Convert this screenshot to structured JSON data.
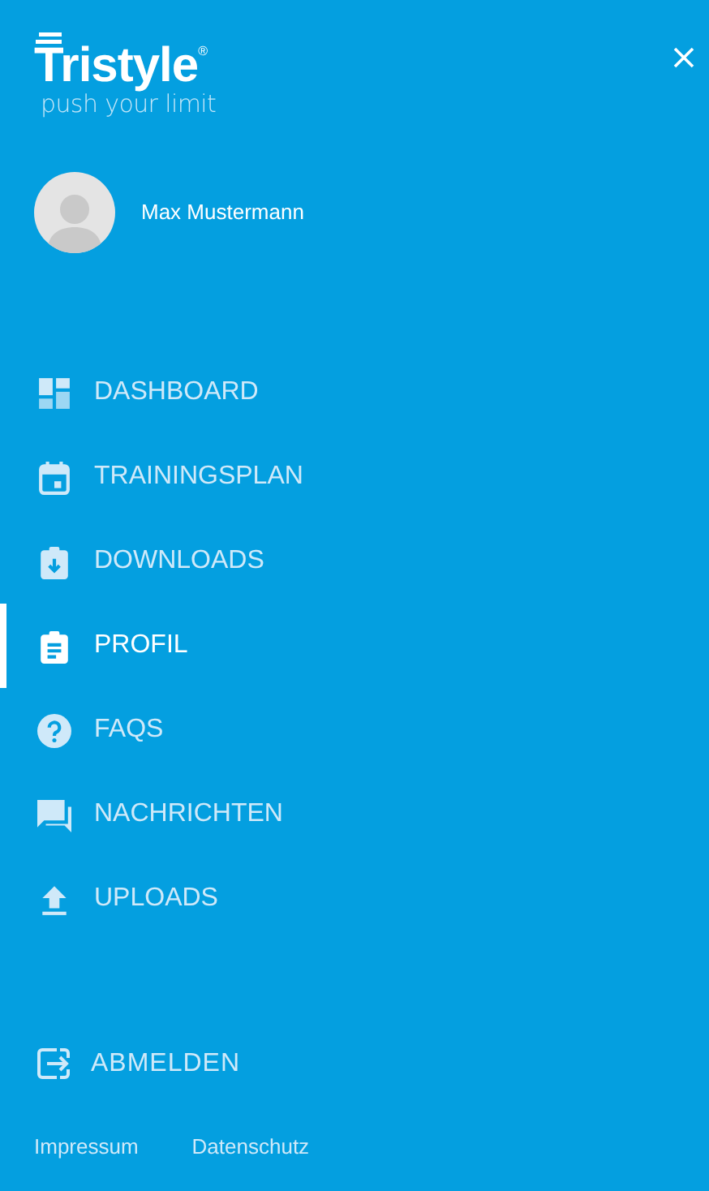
{
  "logo": {
    "name": "Tristyle",
    "mark": "®",
    "tagline": "push your limit"
  },
  "user": {
    "name": "Max Mustermann"
  },
  "nav": [
    {
      "label": "DASHBOARD",
      "selected": false
    },
    {
      "label": "TRAININGSPLAN",
      "selected": false
    },
    {
      "label": "DOWNLOADS",
      "selected": false
    },
    {
      "label": "PROFIL",
      "selected": true
    },
    {
      "label": "FAQS",
      "selected": false
    },
    {
      "label": "NACHRICHTEN",
      "selected": false
    },
    {
      "label": "UPLOADS",
      "selected": false
    }
  ],
  "logout": {
    "label": "ABMELDEN"
  },
  "footer_links": [
    "Impressum",
    "Datenschutz"
  ]
}
